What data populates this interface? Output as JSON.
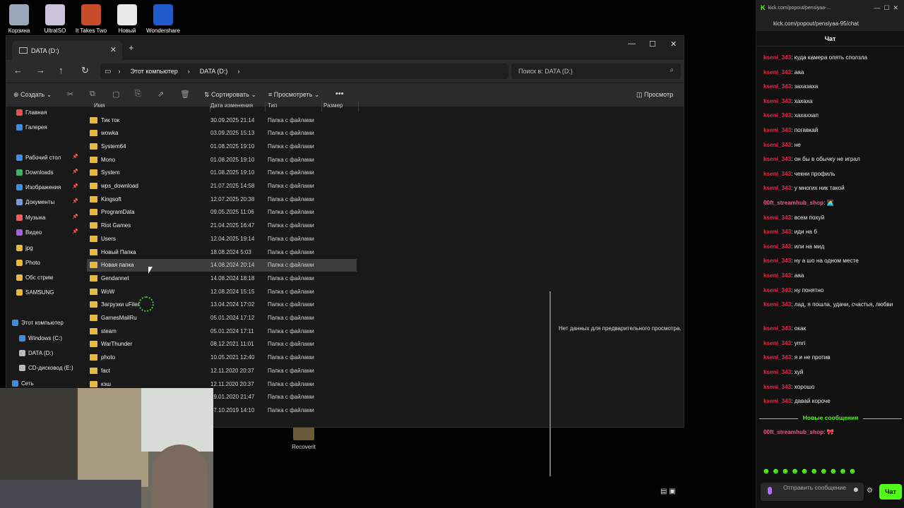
{
  "desktop": {
    "icons": [
      {
        "label": "Корзина",
        "color": "#9aa7b8"
      },
      {
        "label": "UltraISO",
        "color": "#c9c2d8"
      },
      {
        "label": "It Takes Two",
        "color": "#c84b2a"
      },
      {
        "label": "Новый",
        "color": "#e9e9e9"
      },
      {
        "label": "Wondershare",
        "color": "#1f5ac8"
      }
    ],
    "recover_label": "Recoverit"
  },
  "explorer": {
    "tab_title": "DATA (D:)",
    "new_tab": "+",
    "breadcrumb": [
      "Этот компьютер",
      "DATA (D:)"
    ],
    "search_placeholder": "Поиск в: DATA (D:)",
    "toolbar": {
      "create": "Создать",
      "sort": "Сортировать",
      "view": "Просмотреть",
      "more": "•••",
      "preview": "Просмотр"
    },
    "nav": [
      {
        "label": "Главная",
        "color": "#e85050",
        "y": 0
      },
      {
        "label": "Галерея",
        "color": "#3a8ee6",
        "y": 0
      },
      {
        "label": "Рабочий стол",
        "color": "#3a8ee6",
        "pinned": true
      },
      {
        "label": "Downloads",
        "color": "#3ab06a",
        "pinned": true
      },
      {
        "label": "Изображения",
        "color": "#3a8ee6",
        "pinned": true
      },
      {
        "label": "Документы",
        "color": "#7b9ad8",
        "pinned": true
      },
      {
        "label": "Музыка",
        "color": "#e86060",
        "pinned": true
      },
      {
        "label": "Видео",
        "color": "#a060e0",
        "pinned": true
      },
      {
        "label": "jpg",
        "color": "#e8b840"
      },
      {
        "label": "Photo",
        "color": "#e8b840"
      },
      {
        "label": "Обс стрим",
        "color": "#e8b840"
      },
      {
        "label": "SAMSUNG",
        "color": "#e8b840"
      },
      {
        "label": "Этот компьютер",
        "color": "#3a8ee6"
      },
      {
        "label": "Windows (C:)",
        "color": "#3a8ee6"
      },
      {
        "label": "DATA (D:)",
        "color": "#bbbbbb"
      },
      {
        "label": "CD-дисковод (E:)",
        "color": "#bbbbbb"
      },
      {
        "label": "Сеть",
        "color": "#3a8ee6"
      }
    ],
    "columns": [
      "Имя",
      "Дата изменения",
      "Тип",
      "Размер"
    ],
    "files": [
      {
        "name": "Тик ток",
        "date": "30.09.2025 21:14",
        "type": "Папка с файлами"
      },
      {
        "name": "wowka",
        "date": "03.09.2025 15:13",
        "type": "Папка с файлами"
      },
      {
        "name": "System64",
        "date": "01.08.2025 19:10",
        "type": "Папка с файлами"
      },
      {
        "name": "Mono",
        "date": "01.08.2025 19:10",
        "type": "Папка с файлами"
      },
      {
        "name": "System",
        "date": "01.08.2025 19:10",
        "type": "Папка с файлами"
      },
      {
        "name": "wps_download",
        "date": "21.07.2025 14:58",
        "type": "Папка с файлами"
      },
      {
        "name": "Kingsoft",
        "date": "12.07.2025 20:38",
        "type": "Папка с файлами"
      },
      {
        "name": "ProgramData",
        "date": "09.05.2025 11:06",
        "type": "Папка с файлами"
      },
      {
        "name": "Riot Games",
        "date": "21.04.2025 16:47",
        "type": "Папка с файлами"
      },
      {
        "name": "Users",
        "date": "12.04.2025 19:14",
        "type": "Папка с файлами"
      },
      {
        "name": "Новый Папка",
        "date": "18.08.2024 5:03",
        "type": "Папка с файлами"
      },
      {
        "name": "Новая папка",
        "date": "14.08.2024 20:14",
        "type": "Папка с файлами",
        "selected": true
      },
      {
        "name": "Gendannet",
        "date": "14.08.2024 18:18",
        "type": "Папка с файлами"
      },
      {
        "name": "WoW",
        "date": "12.08.2024 15:15",
        "type": "Папка с файлами"
      },
      {
        "name": "Загрузки uFiler",
        "date": "13.04.2024 17:02",
        "type": "Папка с файлами"
      },
      {
        "name": "GamesMailRu",
        "date": "05.01.2024 17:12",
        "type": "Папка с файлами"
      },
      {
        "name": "steam",
        "date": "05.01.2024 17:11",
        "type": "Папка с файлами"
      },
      {
        "name": "WarThunder",
        "date": "08.12.2021 11:01",
        "type": "Папка с файлами"
      },
      {
        "name": "photo",
        "date": "10.05.2021 12:40",
        "type": "Папка с файлами"
      },
      {
        "name": "fact",
        "date": "12.11.2020 20:37",
        "type": "Папка с файлами"
      },
      {
        "name": "кэш",
        "date": "12.11.2020 20:37",
        "type": "Папка с файлами"
      },
      {
        "name": "",
        "date": "19.01.2020 21:47",
        "type": "Папка с файлами"
      },
      {
        "name": "",
        "date": "27.10.2019 14:10",
        "type": "Папка с файлами"
      }
    ],
    "preview_text": "Нет данных для предварительного просмотра."
  },
  "chat": {
    "tab_url": "kick.com/popout/pensiyaa-...",
    "url": "kick.com/popout/pensiyaa-95/chat",
    "title": "Чат",
    "messages": [
      {
        "user": "kseni_343",
        "text": ": куда камера опять сползла"
      },
      {
        "user": "kseni_343",
        "text": ": ааа"
      },
      {
        "user": "kseni_343",
        "text": ": захазаха"
      },
      {
        "user": "kseni_343",
        "text": ": хахаха"
      },
      {
        "user": "kseni_343",
        "text": ": хахаххап"
      },
      {
        "user": "kseni_343",
        "text": ": погавкай"
      },
      {
        "user": "kseni_343",
        "text": ": не"
      },
      {
        "user": "kseni_343",
        "text": ": он бы в обычку не играл"
      },
      {
        "user": "kseni_343",
        "text": ": чекни профиль"
      },
      {
        "user": "kseni_343",
        "text": ": у многих ник такой"
      },
      {
        "user": "00ft_streamhub_shop",
        "text": ": 🧑‍💻",
        "alt": true
      },
      {
        "user": "kseni_343",
        "text": ": всем похуй"
      },
      {
        "user": "kseni_343",
        "text": ": иди на б"
      },
      {
        "user": "kseni_343",
        "text": ": или на мид"
      },
      {
        "user": "kseni_343",
        "text": ": ну а шо на одном месте"
      },
      {
        "user": "kseni_343",
        "text": ": ааа"
      },
      {
        "user": "kseni_343",
        "text": ": ну понятно"
      },
      {
        "user": "kseni_343",
        "text": ": лад, я пошла, удачи, счастья, любви",
        "tall": true
      },
      {
        "user": "kseni_343",
        "text": ": окак"
      },
      {
        "user": "kseni_343",
        "text": ": ymri"
      },
      {
        "user": "kseni_343",
        "text": ": я и не против"
      },
      {
        "user": "kseni_343",
        "text": ": хуй"
      },
      {
        "user": "kseni_343",
        "text": ": хорошо"
      },
      {
        "user": "kseni_343",
        "text": ": давай короче"
      }
    ],
    "new_messages": "Новые сообщения",
    "last_message": {
      "user": "00ft_streamhub_shop",
      "text": ": 🎀"
    },
    "emotes": "☻☻☻☻☻☻☻☻☻☻",
    "input_placeholder": "Отправить сообщение",
    "send_label": "Чат",
    "accent": "#53fc18"
  }
}
